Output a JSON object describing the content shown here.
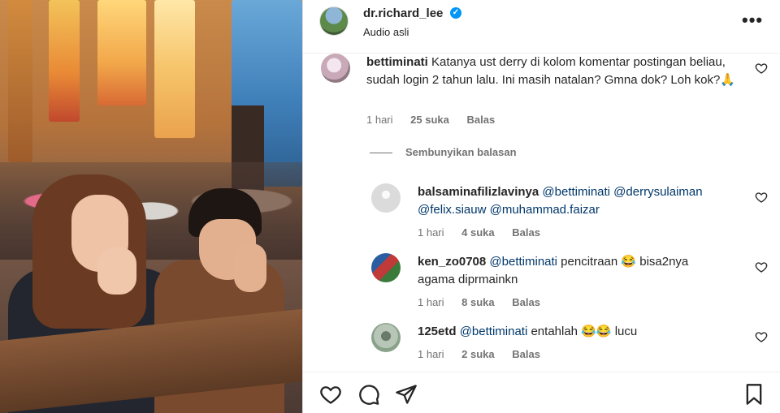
{
  "post": {
    "username": "dr.richard_lee",
    "verified_glyph": "✓",
    "audio": "Audio asli",
    "more_glyph": "•••"
  },
  "comments": [
    {
      "user": "bettiminati",
      "text": "Katanya ust derry di kolom komentar postingan beliau, sudah login 2 tahun lalu. Ini masih natalan? Gmna dok? Loh kok?🙏",
      "time": "1 hari",
      "likes": "25 suka",
      "reply": "Balas"
    }
  ],
  "hide_replies": "Sembunyikan balasan",
  "replies": [
    {
      "user": "balsaminafilizlavinya",
      "mentions": [
        "@bettiminati",
        "@derrysulaiman",
        "@felix.siauw",
        "@muhammad.faizar"
      ],
      "text": "",
      "time": "1 hari",
      "likes": "4 suka",
      "reply": "Balas"
    },
    {
      "user": "ken_zo0708",
      "mention": "@bettiminati",
      "text1": "pencitraan 😂 bisa2nya",
      "text2": "agama diprmainkn",
      "time": "1 hari",
      "likes": "8 suka",
      "reply": "Balas"
    },
    {
      "user": "125etd",
      "mention": "@bettiminati",
      "text": "entahlah 😂😂 lucu",
      "time": "1 hari",
      "likes": "2 suka",
      "reply": "Balas"
    }
  ],
  "icons": {
    "like": "heart-icon",
    "comment": "comment-icon",
    "share": "send-icon",
    "save": "bookmark-icon",
    "more": "more-options-icon"
  },
  "colors": {
    "verified": "#0095f6",
    "mention": "#00376b",
    "muted": "#737373"
  }
}
